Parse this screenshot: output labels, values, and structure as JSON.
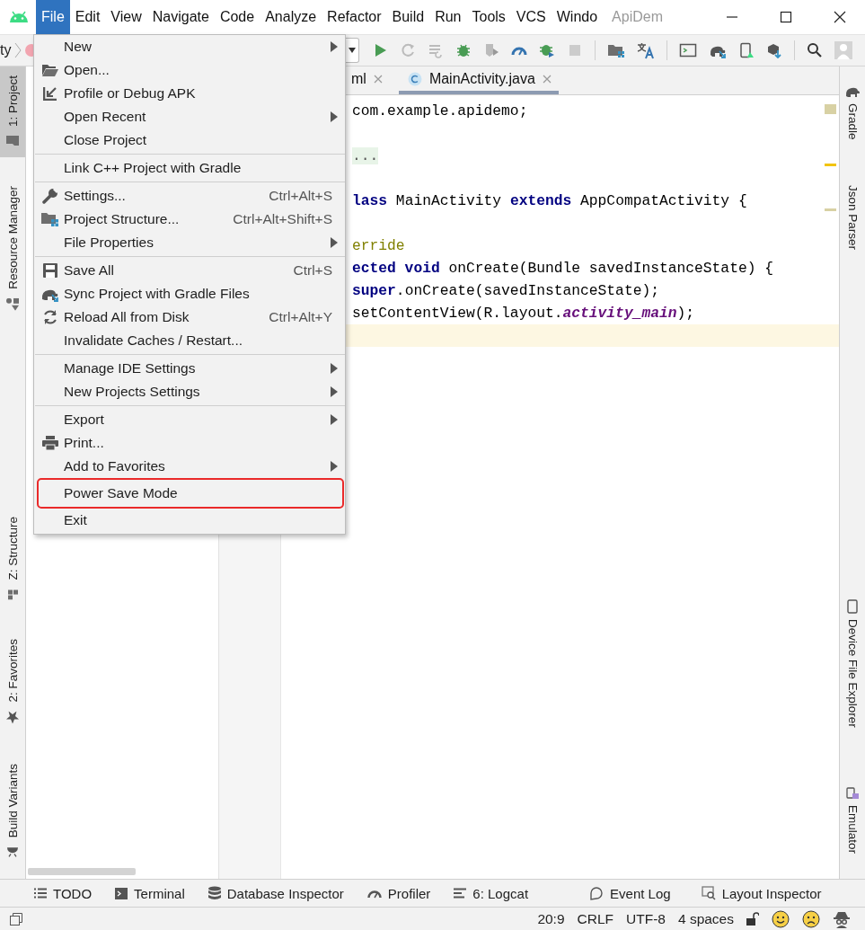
{
  "menubar": {
    "items": [
      {
        "label": "File",
        "selected": true
      },
      {
        "label": "Edit",
        "selected": false
      },
      {
        "label": "View",
        "selected": false
      },
      {
        "label": "Navigate",
        "selected": false
      },
      {
        "label": "Code",
        "selected": false
      },
      {
        "label": "Analyze",
        "selected": false
      },
      {
        "label": "Refactor",
        "selected": false
      },
      {
        "label": "Build",
        "selected": false
      },
      {
        "label": "Run",
        "selected": false
      },
      {
        "label": "Tools",
        "selected": false
      },
      {
        "label": "VCS",
        "selected": false
      },
      {
        "label": "Windo",
        "selected": false
      }
    ],
    "title": "ApiDem"
  },
  "breadcrumb": {
    "text": "ty"
  },
  "editor_tabs": [
    {
      "label": "ml",
      "selected": false
    },
    {
      "label": "MainActivity.java",
      "selected": true
    }
  ],
  "left_tool_tabs": [
    {
      "label": "1: Project",
      "selected": true
    },
    {
      "label": "Resource Manager",
      "selected": false
    },
    {
      "label": "Z: Structure",
      "selected": false
    },
    {
      "label": "2: Favorites",
      "selected": false
    },
    {
      "label": "Build Variants",
      "selected": false
    }
  ],
  "right_tool_tabs": [
    {
      "label": "Gradle"
    },
    {
      "label": "Json Parser"
    },
    {
      "label": "Device File Explorer"
    },
    {
      "label": "Emulator"
    }
  ],
  "code_lines": [
    {
      "current": false,
      "tokens": [
        {
          "text": "com.example.apidemo;",
          "kind": "plain"
        }
      ]
    },
    {
      "current": false
    },
    {
      "current": false,
      "tokens": [
        {
          "text": "...",
          "kind": "fold"
        }
      ]
    },
    {
      "current": false
    },
    {
      "current": false,
      "tokens": [
        {
          "text": "lass ",
          "kind": "keyword"
        },
        {
          "text": "MainActivity ",
          "kind": "plain"
        },
        {
          "text": "extends ",
          "kind": "keyword"
        },
        {
          "text": "AppCompatActivity {",
          "kind": "plain"
        }
      ]
    },
    {
      "current": false
    },
    {
      "current": false,
      "tokens": [
        {
          "text": "erride",
          "kind": "annotation"
        }
      ]
    },
    {
      "current": false,
      "tokens": [
        {
          "text": "ected void ",
          "kind": "keyword"
        },
        {
          "text": "onCreate(Bundle savedInstanceState) {",
          "kind": "plain"
        }
      ]
    },
    {
      "current": false,
      "tokens": [
        {
          "text": "super",
          "kind": "keyword"
        },
        {
          "text": ".onCreate(savedInstanceState);",
          "kind": "plain"
        }
      ]
    },
    {
      "current": false,
      "tokens": [
        {
          "text": "setContentView(R.layout.",
          "kind": "plain"
        },
        {
          "text": "activity_main",
          "kind": "field"
        },
        {
          "text": ");",
          "kind": "plain"
        }
      ]
    },
    {
      "current": true
    }
  ],
  "file_menu": {
    "groups": [
      {
        "items": [
          {
            "label": "New",
            "submenu": true,
            "outlined": false
          },
          {
            "label": "Open...",
            "submenu": false,
            "outlined": false
          },
          {
            "label": "Profile or Debug APK",
            "submenu": false,
            "outlined": false
          },
          {
            "label": "Open Recent",
            "submenu": true,
            "outlined": false
          },
          {
            "label": "Close Project",
            "submenu": false,
            "outlined": false
          }
        ]
      },
      {
        "items": [
          {
            "label": "Link C++ Project with Gradle",
            "submenu": false,
            "outlined": false
          }
        ]
      },
      {
        "items": [
          {
            "label": "Settings...",
            "shortcut": "Ctrl+Alt+S",
            "submenu": false,
            "outlined": false
          },
          {
            "label": "Project Structure...",
            "shortcut": "Ctrl+Alt+Shift+S",
            "submenu": false,
            "outlined": false
          },
          {
            "label": "File Properties",
            "submenu": true,
            "outlined": false
          }
        ]
      },
      {
        "items": [
          {
            "label": "Save All",
            "shortcut": "Ctrl+S",
            "submenu": false,
            "outlined": false
          },
          {
            "label": "Sync Project with Gradle Files",
            "submenu": false,
            "outlined": false
          },
          {
            "label": "Reload All from Disk",
            "shortcut": "Ctrl+Alt+Y",
            "submenu": false,
            "outlined": false
          },
          {
            "label": "Invalidate Caches / Restart...",
            "submenu": false,
            "outlined": false
          }
        ]
      },
      {
        "items": [
          {
            "label": "Manage IDE Settings",
            "submenu": true,
            "outlined": false
          },
          {
            "label": "New Projects Settings",
            "submenu": true,
            "outlined": false
          }
        ]
      },
      {
        "items": [
          {
            "label": "Export",
            "submenu": true,
            "outlined": false
          },
          {
            "label": "Print...",
            "submenu": false,
            "outlined": false
          },
          {
            "label": "Add to Favorites",
            "submenu": true,
            "outlined": false
          },
          {
            "label": "Power Save Mode",
            "submenu": false,
            "outlined": true
          },
          {
            "label": "Exit",
            "submenu": false,
            "outlined": false
          }
        ]
      }
    ]
  },
  "bottom_tools": [
    {
      "label": "TODO"
    },
    {
      "label": "Terminal"
    },
    {
      "label": "Database Inspector"
    },
    {
      "label": "Profiler"
    },
    {
      "label": "6: Logcat"
    },
    {
      "label": "Event Log"
    },
    {
      "label": "Layout Inspector"
    }
  ],
  "status_bar": {
    "items": [
      "20:9",
      "CRLF",
      "UTF-8",
      "4 spaces"
    ]
  }
}
